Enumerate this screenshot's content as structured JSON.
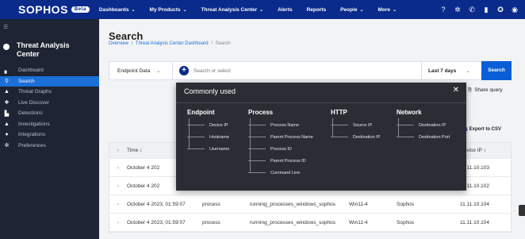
{
  "topnav": {
    "logo": "SOPHOS",
    "badge": "Beta",
    "items": [
      "Dashboards",
      "My Products",
      "Threat Analysis Center",
      "Alerts",
      "Reports",
      "People",
      "More"
    ],
    "chevron_items": [
      true,
      true,
      true,
      false,
      false,
      true,
      true
    ],
    "icons": [
      "help-icon",
      "gear-icon",
      "phone-icon",
      "notification-icon",
      "info-icon",
      "account-icon"
    ]
  },
  "sidebar": {
    "section_title": "Threat Analysis Center",
    "items": [
      {
        "label": "Dashboard",
        "icon": "chart-icon",
        "active": false
      },
      {
        "label": "Search",
        "icon": "search-icon",
        "active": true
      },
      {
        "label": "Threat Graphs",
        "icon": "threat-graph-icon",
        "active": false
      },
      {
        "label": "Live Discover",
        "icon": "live-discover-icon",
        "active": false
      },
      {
        "label": "Detections",
        "icon": "detections-icon",
        "active": false
      },
      {
        "label": "Investigations",
        "icon": "investigations-icon",
        "active": false
      },
      {
        "label": "Integrations",
        "icon": "integrations-icon",
        "active": false
      },
      {
        "label": "Preferences",
        "icon": "gear-icon",
        "active": false
      }
    ]
  },
  "page": {
    "title": "Search",
    "breadcrumb": [
      "Overview",
      "Threat Analysis Center Dashboard",
      "Search"
    ]
  },
  "search": {
    "data_source": "Endpoint Data",
    "placeholder": "Search or select",
    "range": "Last 7 days",
    "button": "Search",
    "share": "Share query",
    "export": "Export to CSV"
  },
  "table": {
    "headers": {
      "time": "Time ↕",
      "ip": "Device IP ↕"
    },
    "rows": [
      {
        "time": "October 4 202",
        "type": "",
        "query": "",
        "host": "",
        "vendor": "",
        "ip": "11.11.10.103"
      },
      {
        "time": "October 4 202",
        "type": "",
        "query": "",
        "host": "",
        "vendor": "",
        "ip": "11.11.10.102"
      },
      {
        "time": "October 4 2023, 01:59:07",
        "type": "process",
        "query": "running_processes_windows_sophos",
        "host": "Win11-4",
        "vendor": "Sophos",
        "ip": "11.11.10.104"
      },
      {
        "time": "October 4 2023, 01:59:07",
        "type": "process",
        "query": "running_processes_windows_sophos",
        "host": "Win11-4",
        "vendor": "Sophos",
        "ip": "11.11.10.104"
      }
    ]
  },
  "popup": {
    "title": "Commonly used",
    "close": "✕",
    "groups": [
      {
        "title": "Endpoint",
        "items": [
          "Device IP",
          "Hostname",
          "Username"
        ]
      },
      {
        "title": "Process",
        "items": [
          "Process Name",
          "Parent Process Name",
          "Process ID",
          "Parent Process ID",
          "Command Line"
        ]
      },
      {
        "title": "HTTP",
        "items": [
          "Source IP",
          "Destination IP"
        ]
      },
      {
        "title": "Network",
        "items": [
          "Destination IP",
          "Destination Port"
        ]
      }
    ]
  }
}
